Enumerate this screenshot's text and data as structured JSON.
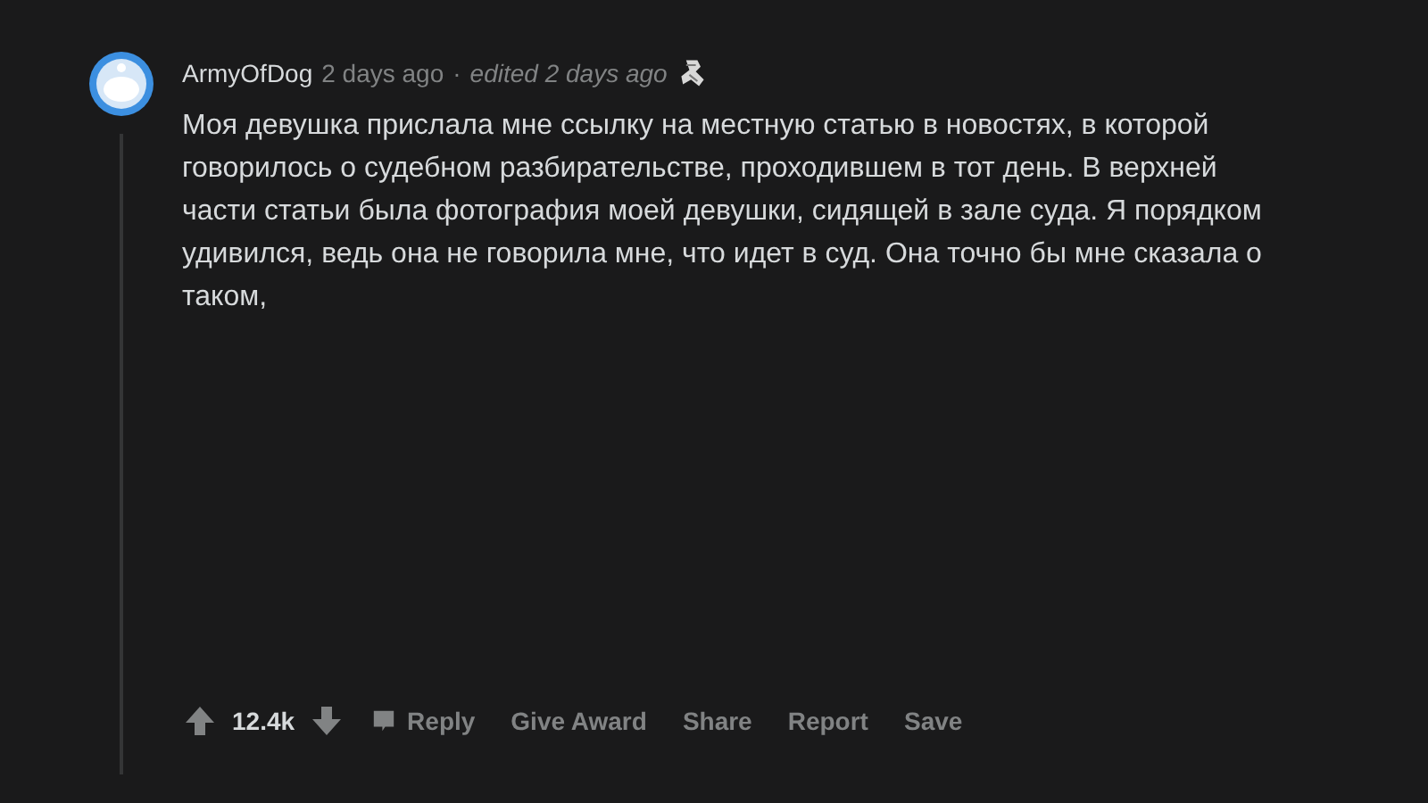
{
  "comment": {
    "author": "ArmyOfDog",
    "time": "2 days ago",
    "separator": "·",
    "edited": "edited 2 days ago",
    "body": "Моя девушка прислала мне ссылку на местную статью в новостях, в которой говорилось о судебном разбирательстве, проходившем в тот день. В верхней части статьи была фотография моей девушки, сидящей в зале суда. Я порядком удивился, ведь она не говорила мне, что идет в суд. Она точно бы мне сказала о таком,",
    "score": "12.4k",
    "actions": [
      {
        "kind": "reply",
        "label": "Reply"
      },
      {
        "kind": "plain",
        "label": "Give Award"
      },
      {
        "kind": "plain",
        "label": "Share"
      },
      {
        "kind": "plain",
        "label": "Report"
      },
      {
        "kind": "plain",
        "label": "Save"
      }
    ]
  }
}
